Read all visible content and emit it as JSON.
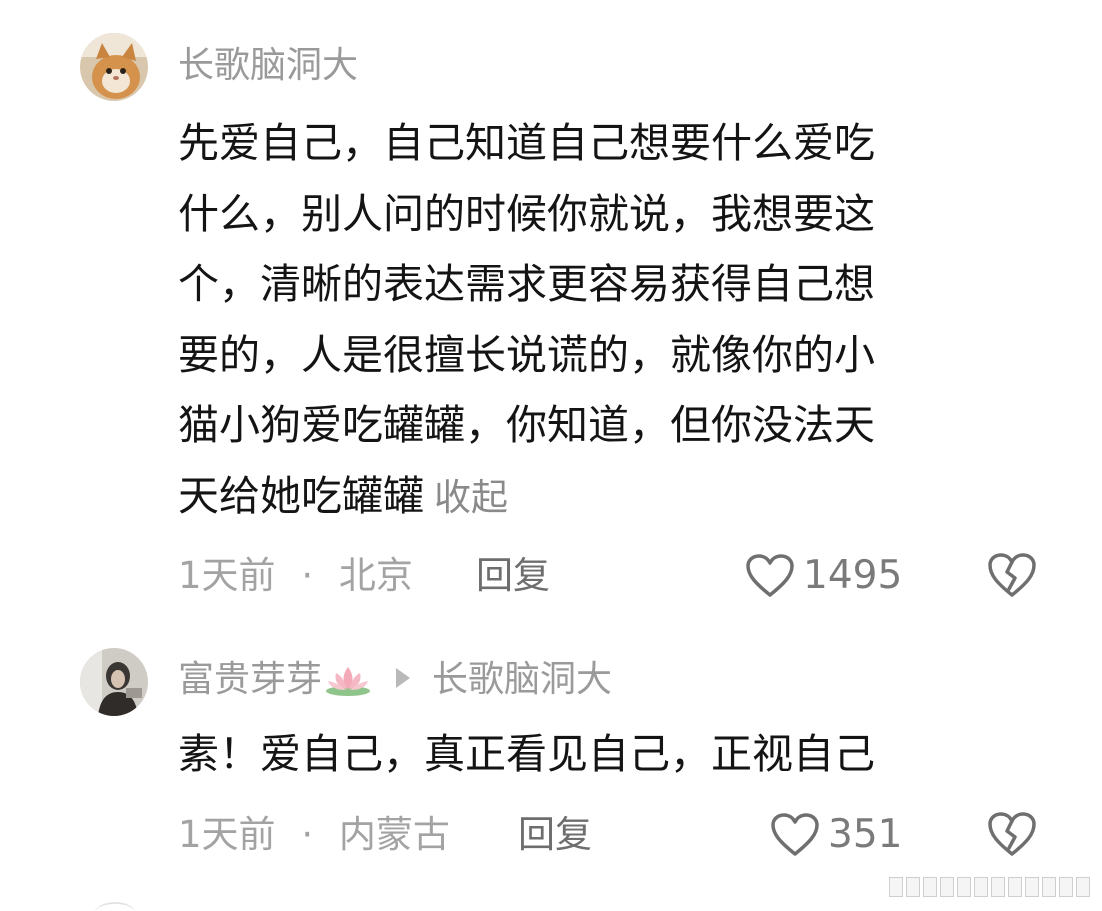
{
  "comments": [
    {
      "username": "长歌脑洞大",
      "text_lines": [
        "先爱自己，自己知道自己想要什么爱吃",
        "什么，别人问的时候你就说，我想要这",
        "个，清晰的表达需求更容易获得自己想",
        "要的，人是很擅长说谎的，就像你的小",
        "猫小狗爱吃罐罐，你知道，但你没法天",
        "天给她吃罐罐"
      ],
      "collapse_label": "收起",
      "time": "1天前",
      "separator": "·",
      "location": "北京",
      "reply_label": "回复",
      "likes": "1495"
    },
    {
      "username": "富贵芽芽",
      "reply_to": "长歌脑洞大",
      "text": "素！爱自己，真正看见自己，正视自己",
      "time": "1天前",
      "separator": "·",
      "location": "内蒙古",
      "reply_label": "回复",
      "likes": "351"
    }
  ],
  "icons": {
    "like": "heart-outline-icon",
    "dislike": "broken-heart-icon",
    "reply_arrow": "play-triangle-icon",
    "lotus": "lotus-emoji-icon"
  },
  "colors": {
    "username": "#9a9a9a",
    "body_text": "#141414",
    "meta_text": "#a3a3a3",
    "icon_stroke": "#6f6f6f"
  }
}
